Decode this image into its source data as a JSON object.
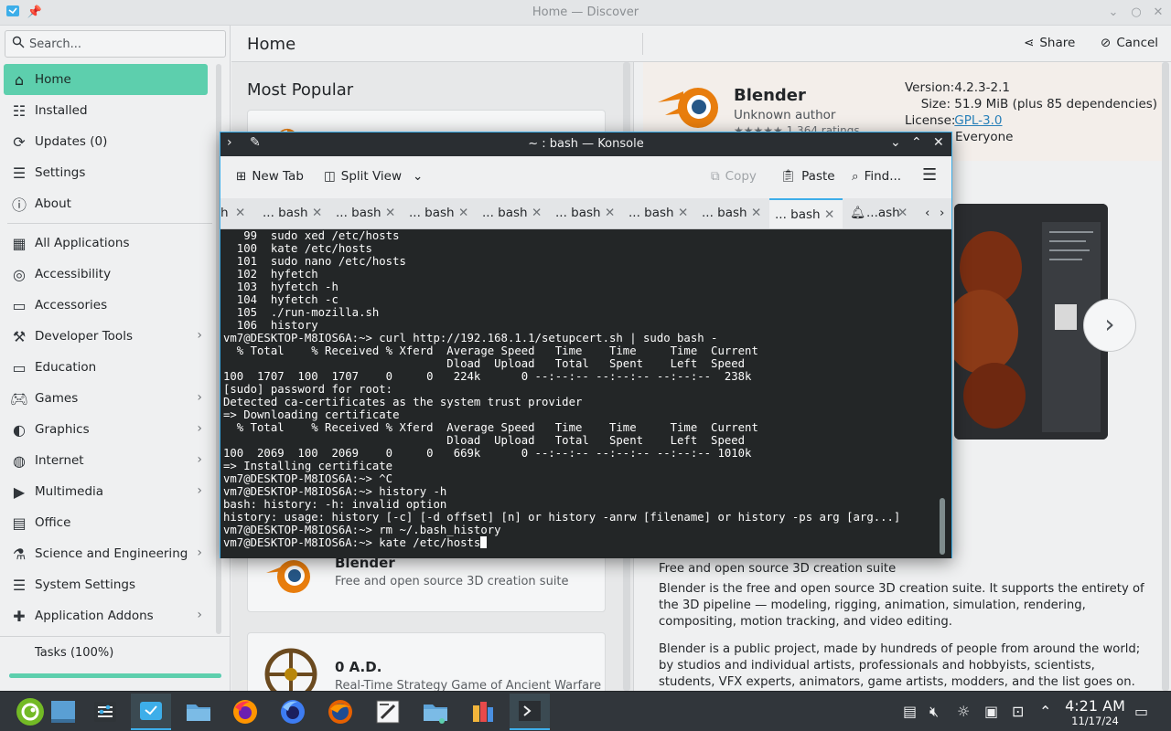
{
  "discover": {
    "window_title": "Home — Discover",
    "search_placeholder": "Search...",
    "header_title": "Home",
    "share_label": "Share",
    "cancel_label": "Cancel",
    "sidebar": {
      "items": [
        {
          "label": "Home",
          "icon": "home-icon"
        },
        {
          "label": "Installed",
          "icon": "installed-icon"
        },
        {
          "label": "Updates (0)",
          "icon": "updates-icon"
        },
        {
          "label": "Settings",
          "icon": "settings-icon"
        },
        {
          "label": "About",
          "icon": "about-icon"
        }
      ],
      "categories": [
        {
          "label": "All Applications"
        },
        {
          "label": "Accessibility"
        },
        {
          "label": "Accessories"
        },
        {
          "label": "Developer Tools"
        },
        {
          "label": "Education"
        },
        {
          "label": "Games"
        },
        {
          "label": "Graphics"
        },
        {
          "label": "Internet"
        },
        {
          "label": "Multimedia"
        },
        {
          "label": "Office"
        },
        {
          "label": "Science and Engineering"
        },
        {
          "label": "System Settings"
        },
        {
          "label": "Application Addons"
        }
      ],
      "tasks_label": "Tasks (100%)"
    },
    "list": {
      "section_title": "Most Popular",
      "cards": [
        {
          "name": "Blender",
          "desc": "Free and open source 3D creation suite"
        },
        {
          "name": "0 A.D.",
          "desc": "Real-Time Strategy Game of Ancient Warfare"
        }
      ]
    },
    "detail": {
      "app_name": "Blender",
      "author": "Unknown author",
      "ratings": "1,364 ratings",
      "version_key": "Version:",
      "version": "4.2.3-2.1",
      "size_key": "Size:",
      "size": "51.9 MiB (plus 85 dependencies)",
      "license_key": "License:",
      "license": "GPL-3.0",
      "audience": "Everyone",
      "summary": "Free and open source 3D creation suite",
      "para1": "Blender is the free and open source 3D creation suite. It supports the entirety of the 3D pipeline — modeling, rigging, animation, simulation, rendering, compositing, motion tracking, and video editing.",
      "para2": "Blender is a public project, made by hundreds of people from around the world; by studios and individual artists, professionals and hobbyists, scientists, students, VFX experts, animators, game artists, modders, and the list goes on."
    }
  },
  "konsole": {
    "title": "~ : bash — Konsole",
    "toolbar": {
      "new_tab": "New Tab",
      "split_view": "Split View",
      "copy": "Copy",
      "paste": "Paste",
      "find": "Find..."
    },
    "tabs": [
      "h",
      "... bash",
      "... bash",
      "... bash",
      "... bash",
      "... bash",
      "... bash",
      "... bash",
      "... bash",
      "...ash"
    ],
    "active_tab_index": 8,
    "lines": [
      "   99  sudo xed /etc/hosts",
      "  100  kate /etc/hosts",
      "  101  sudo nano /etc/hosts",
      "  102  hyfetch",
      "  103  hyfetch -h",
      "  104  hyfetch -c",
      "  105  ./run-mozilla.sh",
      "  106  history",
      "vm7@DESKTOP-M8IOS6A:~> curl http://192.168.1.1/setupcert.sh | sudo bash -",
      "  % Total    % Received % Xferd  Average Speed   Time    Time     Time  Current",
      "                                 Dload  Upload   Total   Spent    Left  Speed",
      "100  1707  100  1707    0     0   224k      0 --:--:-- --:--:-- --:--:--  238k",
      "[sudo] password for root:",
      "Detected ca-certificates as the system trust provider",
      "=> Downloading certificate",
      "  % Total    % Received % Xferd  Average Speed   Time    Time     Time  Current",
      "                                 Dload  Upload   Total   Spent    Left  Speed",
      "100  2069  100  2069    0     0   669k      0 --:--:-- --:--:-- --:--:-- 1010k",
      "=> Installing certificate",
      "vm7@DESKTOP-M8IOS6A:~> ^C",
      "vm7@DESKTOP-M8IOS6A:~> history -h",
      "bash: history: -h: invalid option",
      "history: usage: history [-c] [-d offset] [n] or history -anrw [filename] or history -ps arg [arg...]",
      "vm7@DESKTOP-M8IOS6A:~> rm ~/.bash_history"
    ],
    "prompt_line": "vm7@DESKTOP-M8IOS6A:~> kate /etc/hosts"
  },
  "taskbar": {
    "time": "4:21 AM",
    "date": "11/17/24"
  },
  "colors": {
    "accent": "#3daee9",
    "selection": "#5dcfad",
    "terminal_bg": "#232627",
    "taskbar_bg": "#31363b"
  }
}
